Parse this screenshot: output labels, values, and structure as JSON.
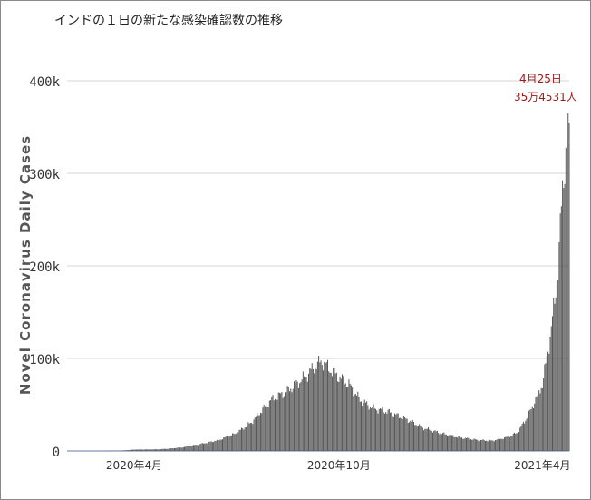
{
  "title": "インドの１日の新たな感染確認数の推移",
  "chart_data": {
    "type": "bar",
    "ylabel": "Novel Coronavirus Daily Cases",
    "ylim": [
      0,
      400000
    ],
    "yticks": [
      {
        "value": 0,
        "label": "0"
      },
      {
        "value": 100000,
        "label": "100k"
      },
      {
        "value": 200000,
        "label": "200k"
      },
      {
        "value": 300000,
        "label": "300k"
      },
      {
        "value": 400000,
        "label": "400k"
      }
    ],
    "xlim": [
      "2020-02-01",
      "2021-04-25"
    ],
    "xticks": [
      {
        "date": "2020-04-01",
        "label": "2020年4月"
      },
      {
        "date": "2020-10-01",
        "label": "2020年10月"
      },
      {
        "date": "2021-04-01",
        "label": "2021年4月"
      }
    ],
    "grid": true,
    "series": [
      {
        "color": "#555555",
        "anchors": [
          [
            "2020-02-01",
            0
          ],
          [
            "2020-03-01",
            0
          ],
          [
            "2020-03-20",
            150
          ],
          [
            "2020-04-01",
            1500
          ],
          [
            "2020-04-20",
            1700
          ],
          [
            "2020-05-01",
            2400
          ],
          [
            "2020-05-15",
            4000
          ],
          [
            "2020-06-01",
            8000
          ],
          [
            "2020-06-15",
            11500
          ],
          [
            "2020-07-01",
            19000
          ],
          [
            "2020-07-15",
            31000
          ],
          [
            "2020-08-01",
            55000
          ],
          [
            "2020-08-15",
            64000
          ],
          [
            "2020-09-01",
            80000
          ],
          [
            "2020-09-10",
            92000
          ],
          [
            "2020-09-16",
            97000
          ],
          [
            "2020-09-25",
            86000
          ],
          [
            "2020-10-01",
            80000
          ],
          [
            "2020-10-10",
            72000
          ],
          [
            "2020-10-20",
            55000
          ],
          [
            "2020-11-01",
            46000
          ],
          [
            "2020-11-15",
            42000
          ],
          [
            "2020-12-01",
            34000
          ],
          [
            "2020-12-15",
            25000
          ],
          [
            "2021-01-01",
            19000
          ],
          [
            "2021-01-15",
            15000
          ],
          [
            "2021-02-01",
            12000
          ],
          [
            "2021-02-15",
            11000
          ],
          [
            "2021-03-01",
            15000
          ],
          [
            "2021-03-10",
            20000
          ],
          [
            "2021-03-20",
            40000
          ],
          [
            "2021-04-01",
            72000
          ],
          [
            "2021-04-05",
            100000
          ],
          [
            "2021-04-08",
            125000
          ],
          [
            "2021-04-12",
            160000
          ],
          [
            "2021-04-15",
            200000
          ],
          [
            "2021-04-18",
            260000
          ],
          [
            "2021-04-21",
            315000
          ],
          [
            "2021-04-23",
            340000
          ],
          [
            "2021-04-25",
            354531
          ]
        ]
      }
    ],
    "annotation": {
      "date": "2021-04-25",
      "value": 354531,
      "line1": "4月25日",
      "line2": "35万4531人",
      "color": "#a01818"
    }
  }
}
